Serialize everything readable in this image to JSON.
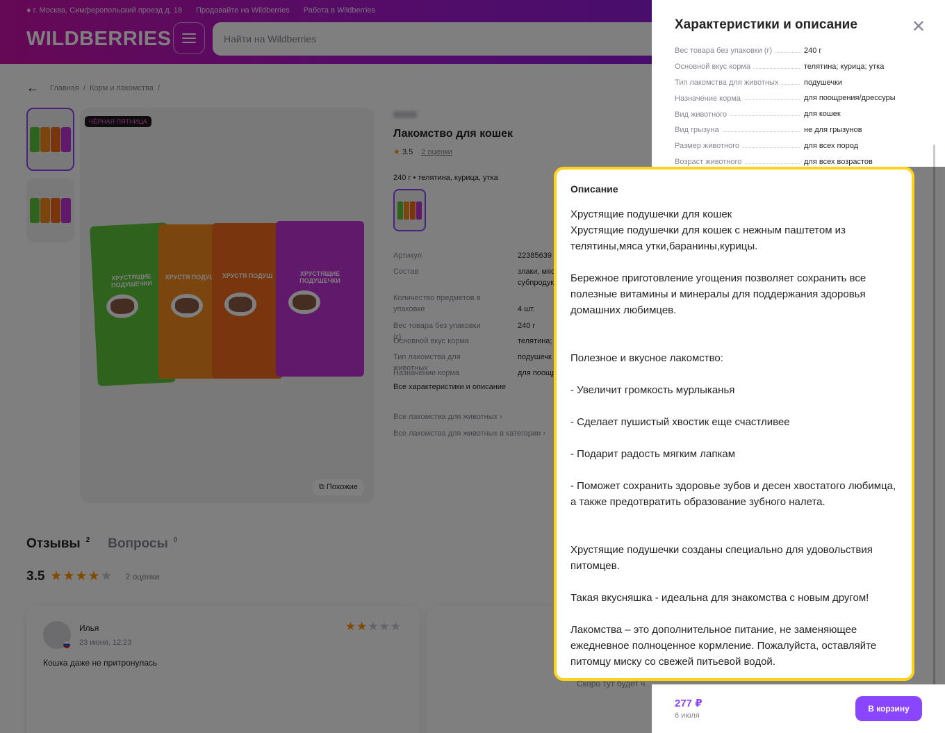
{
  "header": {
    "location": "г. Москва, Симферопольский проезд д. 18",
    "sell_link": "Продавайте на Wildberries",
    "work_link": "Работа в Wildberries",
    "logo": "WILDBERRIES",
    "search_placeholder": "Найти на Wildberries"
  },
  "breadcrumbs": [
    "Главная",
    "Корм и лакомства"
  ],
  "product": {
    "badge": "ЧЁРНАЯ ПЯТНИЦА",
    "title": "Лакомство для кошек",
    "rating": "3.5",
    "ratings_count": "2 оценки",
    "variant": "240 г • телятина, курица, утка",
    "similar_button": "Похожие",
    "pack_label": "ХРУСТЯЩИЕ ПОДУШЕЧКИ",
    "pack_label_short": "ХРУСТЯ ПОДУШ",
    "specs": [
      {
        "k": "Артикул",
        "v": "22385639"
      },
      {
        "k": "Состав",
        "v": "злаки, мяс\nсубпродук"
      },
      {
        "k": "Количество предметов в упаковке",
        "v": "4 шт."
      },
      {
        "k": "Вес товара без упаковки (г)",
        "v": "240 г"
      },
      {
        "k": "Основной вкус корма",
        "v": "телятина; к"
      },
      {
        "k": "Тип лакомства для животных",
        "v": "подушечк"
      },
      {
        "k": "Назначение корма",
        "v": "для поощр"
      }
    ],
    "all_chars_link": "Все характеристики и описание",
    "link_all_treats": "Все лакомства для животных",
    "link_category": "Все лакомства для животных в категории"
  },
  "reviews": {
    "tab_reviews": "Отзывы",
    "tab_reviews_count": "2",
    "tab_questions": "Вопросы",
    "tab_questions_count": "0",
    "score": "3.5",
    "count": "2 оценки",
    "card": {
      "name": "Илья",
      "date": "23 июня, 12:23",
      "text": "Кошка даже не притронулась",
      "stars": 2
    },
    "soon_text": "Скоро тут будет ч"
  },
  "panel": {
    "title": "Характеристики и описание",
    "specs": [
      {
        "k": "Вес товара без упаковки (г)",
        "v": "240 г"
      },
      {
        "k": "Основной вкус корма",
        "v": "телятина; курица; утка"
      },
      {
        "k": "Тип лакомства для животных",
        "v": "подушечки"
      },
      {
        "k": "Назначение корма",
        "v": "для поощрения/дрессуры"
      },
      {
        "k": "Вид животного",
        "v": "для кошек"
      },
      {
        "k": "Вид грызуна",
        "v": "не для грызунов"
      },
      {
        "k": "Размер животного",
        "v": "для всех пород"
      },
      {
        "k": "Возраст животного",
        "v": "для всех возрастов"
      }
    ],
    "price": "277 ₽",
    "delivery_date": "6 июля",
    "cart_button": "В корзину"
  },
  "description": {
    "heading": "Описание",
    "text": "Хрустящие подушечки для кошек\nХрустящие подушечки для кошек с нежным паштетом из телятины,мяса утки,баранины,курицы.\n\nБережное приготовление угощения позволяет сохранить все полезные витамины и минералы для поддержания здоровья домашних любимцев.\n\n\nПолезное и вкусное лакомство:\n\n- Увеличит громкость мурлыканья\n\n- Сделает пушистый хвостик еще счастливее\n\n- Подарит радость мягким лапкам\n\n- Поможет сохранить здоровье зубов и десен хвостатого любимца, а также предотвратить образование зубного налета.\n\n\nХрустящие подушечки созданы специально для удовольствия питомцев.\n\nТакая вкусняшка - идеальна для знакомства с новым другом!\n\nЛакомства – это дополнительное питание, не заменяющее ежедневное полноценное кормление. Пожалуйста, оставляйте питомцу миску со свежей питьевой водой."
  },
  "colors": {
    "brand_gradient_start": "#cb11ab",
    "brand_gradient_end": "#7a1ce0",
    "accent": "#8a46ff",
    "highlight": "#ffd21c",
    "pack_green": "#5cc53a",
    "pack_orange": "#f58a1f",
    "pack_orange2": "#f26a1b",
    "pack_purple": "#c233d6"
  }
}
